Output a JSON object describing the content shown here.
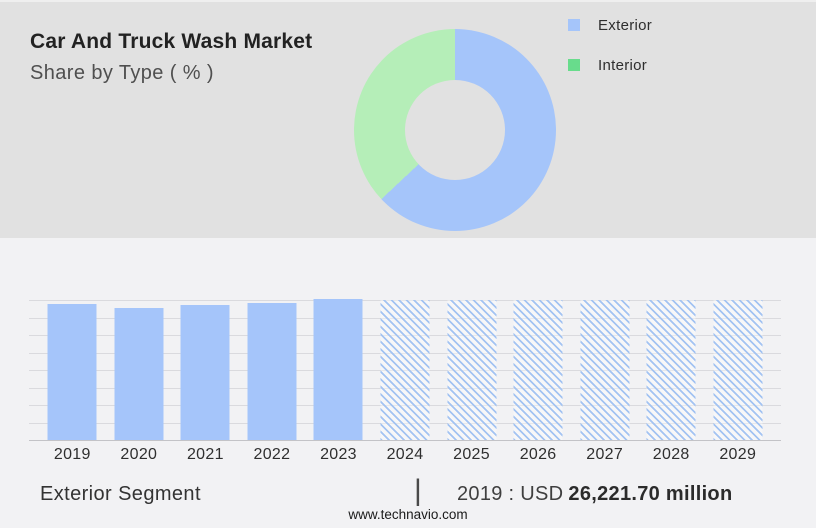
{
  "header": {
    "title": "Car And Truck Wash Market",
    "subtitle": "Share by Type ( % )"
  },
  "legend": {
    "position": "right",
    "items": [
      {
        "label": "Exterior",
        "swatch_color": "#a5c5fa"
      },
      {
        "label": "Interior",
        "swatch_color": "#68dc8c"
      }
    ]
  },
  "chart_data": [
    {
      "type": "pie",
      "style": "donut",
      "title": "Car And Truck Wash Market - Share by Type ( % )",
      "labels": [
        "Exterior",
        "Interior"
      ],
      "values": [
        63,
        37
      ],
      "unit": "%",
      "colors": [
        "#a5c5fa",
        "#b5eeb8"
      ],
      "cutout_pct": 50,
      "start_angle_deg": 0,
      "direction": "clockwise",
      "legend_position": "right"
    },
    {
      "type": "bar",
      "categories": [
        "2019",
        "2020",
        "2021",
        "2022",
        "2023",
        "2024",
        "2025",
        "2026",
        "2027",
        "2028",
        "2029"
      ],
      "values_relative_height_pct": [
        97.5,
        94.5,
        96.2,
        97.7,
        100.5,
        100,
        100,
        100,
        100,
        100,
        100
      ],
      "bar_styles": [
        "solid",
        "solid",
        "solid",
        "solid",
        "solid",
        "hatched",
        "hatched",
        "hatched",
        "hatched",
        "hatched",
        "hatched"
      ],
      "forecast_from": "2024",
      "bar_color": "#a5c5fa",
      "hatch_color": "#a3c3f2",
      "xlabel": "",
      "ylabel": "",
      "y_axis_shown": false,
      "gridline_count": 9,
      "grid": "horizontal",
      "note": "Solid bars 2019-2023 are historic values; hatched bars 2024-2029 are forecast placeholders at full plot height. No numeric y-axis is displayed."
    }
  ],
  "footer": {
    "segment_label": "Exterior Segment",
    "divider": "|",
    "value_prefix": "2019 : USD",
    "value_bold": "26,221.70 million",
    "website": "www.technavio.com"
  },
  "theme": {
    "top_panel_bg": "#e1e1e1",
    "page_bg": "#f2f2f4",
    "gridline_color": "#dadade",
    "axis_line_color": "#c3c3c7"
  }
}
